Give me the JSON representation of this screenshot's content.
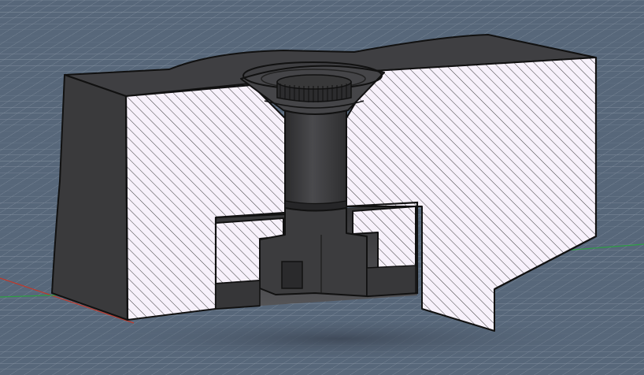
{
  "viewport": {
    "background": "#57677a",
    "grid_color": "#8a97a6",
    "axis_x_color": "#c0392b",
    "axis_y_color": "#2e9e44"
  },
  "model": {
    "body_color": "#3d3d3f",
    "body_dark": "#29292b",
    "body_light": "#4a4a4d",
    "section_fill": "#f7f1fb",
    "hatch_color": "#2a2a2a",
    "edge_color": "#111111"
  }
}
